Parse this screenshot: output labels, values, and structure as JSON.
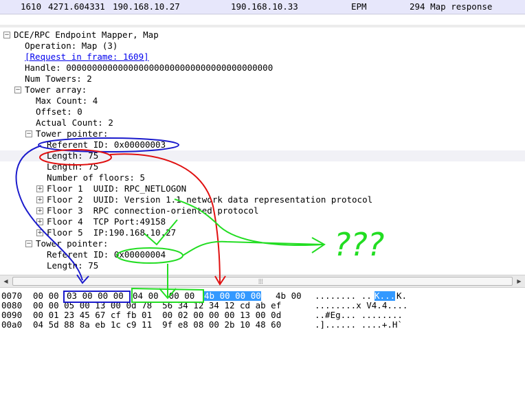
{
  "packet_row": {
    "no": "1610",
    "time": "4271.604331",
    "source": "190.168.10.27",
    "destination": "190.168.10.33",
    "protocol": "EPM",
    "info": "294 Map response"
  },
  "tree": {
    "root": "DCE/RPC Endpoint Mapper, Map",
    "operation": "Operation: Map (3)",
    "request_link": "[Request in frame: 1609]",
    "handle": "Handle: 0000000000000000000000000000000000000000",
    "num_towers": "Num Towers: 2",
    "tower_array": "Tower array:",
    "max_count": "Max Count: 4",
    "offset": "Offset: 0",
    "actual_count": "Actual Count: 2",
    "tower1": {
      "label": "Tower pointer:",
      "referent": "Referent ID: 0x00000003",
      "length_a": "Length: 75",
      "length_b": "Length: 75",
      "floors_count": "Number of floors: 5",
      "floors": [
        "Floor 1  UUID: RPC_NETLOGON",
        "Floor 2  UUID: Version 1.1 network data representation protocol",
        "Floor 3  RPC connection-oriented protocol",
        "Floor 4  TCP Port:49158",
        "Floor 5  IP:190.168.10.27"
      ]
    },
    "tower2": {
      "label": "Tower pointer:",
      "referent": "Referent ID: 0x00000004",
      "length": "Length: 75"
    }
  },
  "hex": [
    {
      "offset": "0070",
      "p1": "00 00",
      "p2": "03 00 00 00",
      "p3": "04 00  00 00",
      "sel": "4b 00 00 00",
      "p4": "4b 00",
      "ascii_a": "........ ..",
      "ascii_sel": "K...",
      "ascii_b": "K."
    },
    {
      "offset": "0080",
      "bytes": "00 00 05 00 13 00 0d 78  56 34 12 34 12 cd ab ef",
      "ascii": "........x V4.4...."
    },
    {
      "offset": "0090",
      "bytes": "00 01 23 45 67 cf fb 01  00 02 00 00 00 13 00 0d",
      "ascii": "..#Eg... ........"
    },
    {
      "offset": "00a0",
      "bytes": "04 5d 88 8a eb 1c c9 11  9f e8 08 00 2b 10 48 60",
      "ascii": ".]...... ....+.H`"
    }
  ],
  "annotation": {
    "text": "???",
    "color": "#22dd22"
  },
  "colors": {
    "selection": "#3399ff",
    "link": "#0000ee",
    "blue_mark": "#1a1acc",
    "red_mark": "#e01010",
    "green_mark": "#22dd22"
  }
}
